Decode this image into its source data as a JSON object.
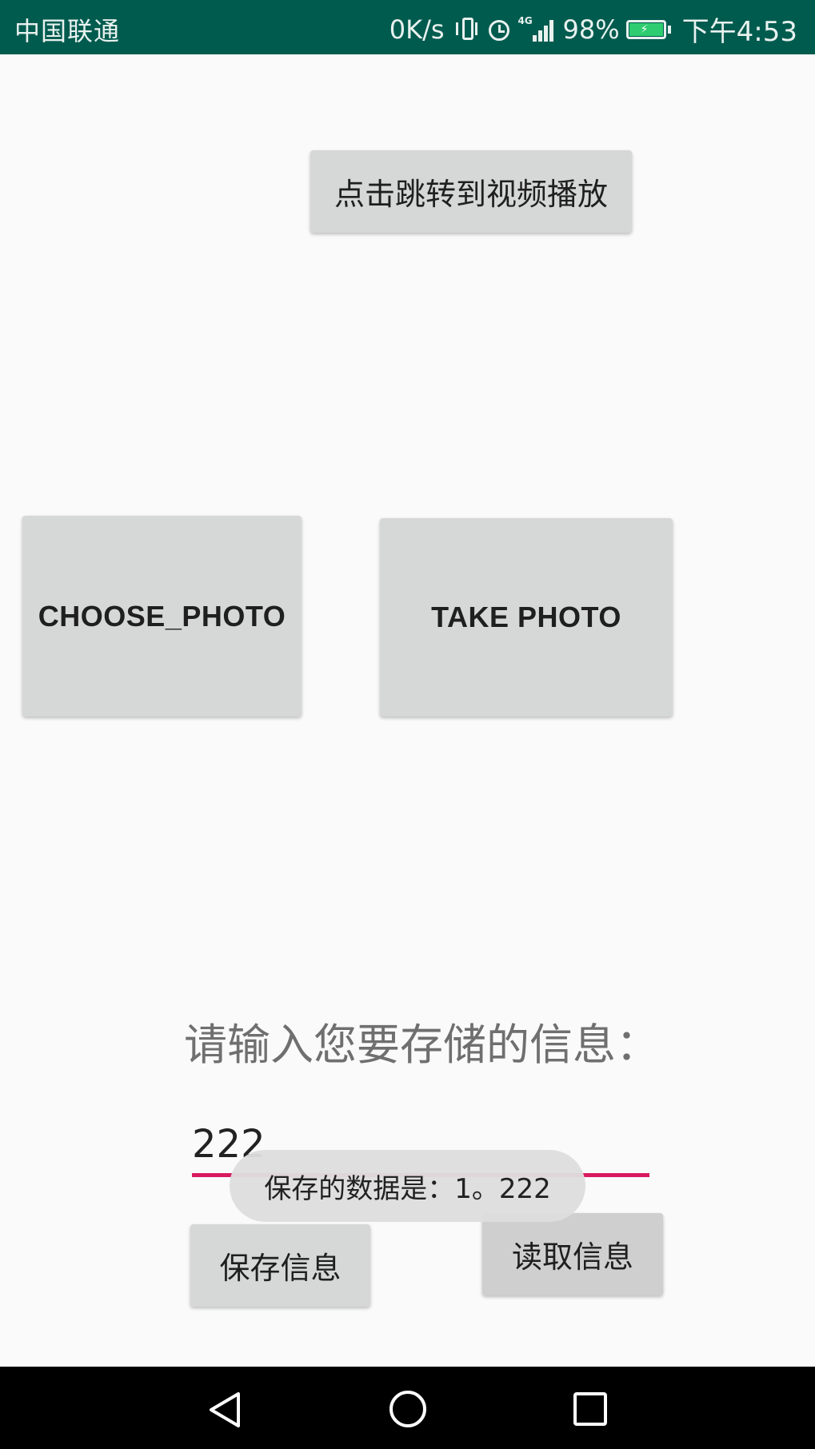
{
  "status_bar": {
    "carrier": "中国联通",
    "net_speed": "0K/s",
    "network_tag": "4G",
    "battery_percent": "98%",
    "time": "下午4:53",
    "icons": [
      "vibrate-icon",
      "alarm-icon",
      "signal-icon",
      "battery-icon"
    ],
    "battery_color": "#2ecc71",
    "bar_color": "#005b4f"
  },
  "buttons": {
    "video": "点击跳转到视频播放",
    "choose_photo": "CHOOSE_PHOTO",
    "take_photo": "TAKE PHOTO",
    "save": "保存信息",
    "read": "读取信息"
  },
  "storage": {
    "prompt": "请输入您要存储的信息：",
    "input_value": "222",
    "underline_color": "#d81b60"
  },
  "toast": {
    "message": "保存的数据是：1。222"
  },
  "nav_bar": {
    "icons": [
      "back-icon",
      "home-icon",
      "recent-apps-icon"
    ]
  }
}
